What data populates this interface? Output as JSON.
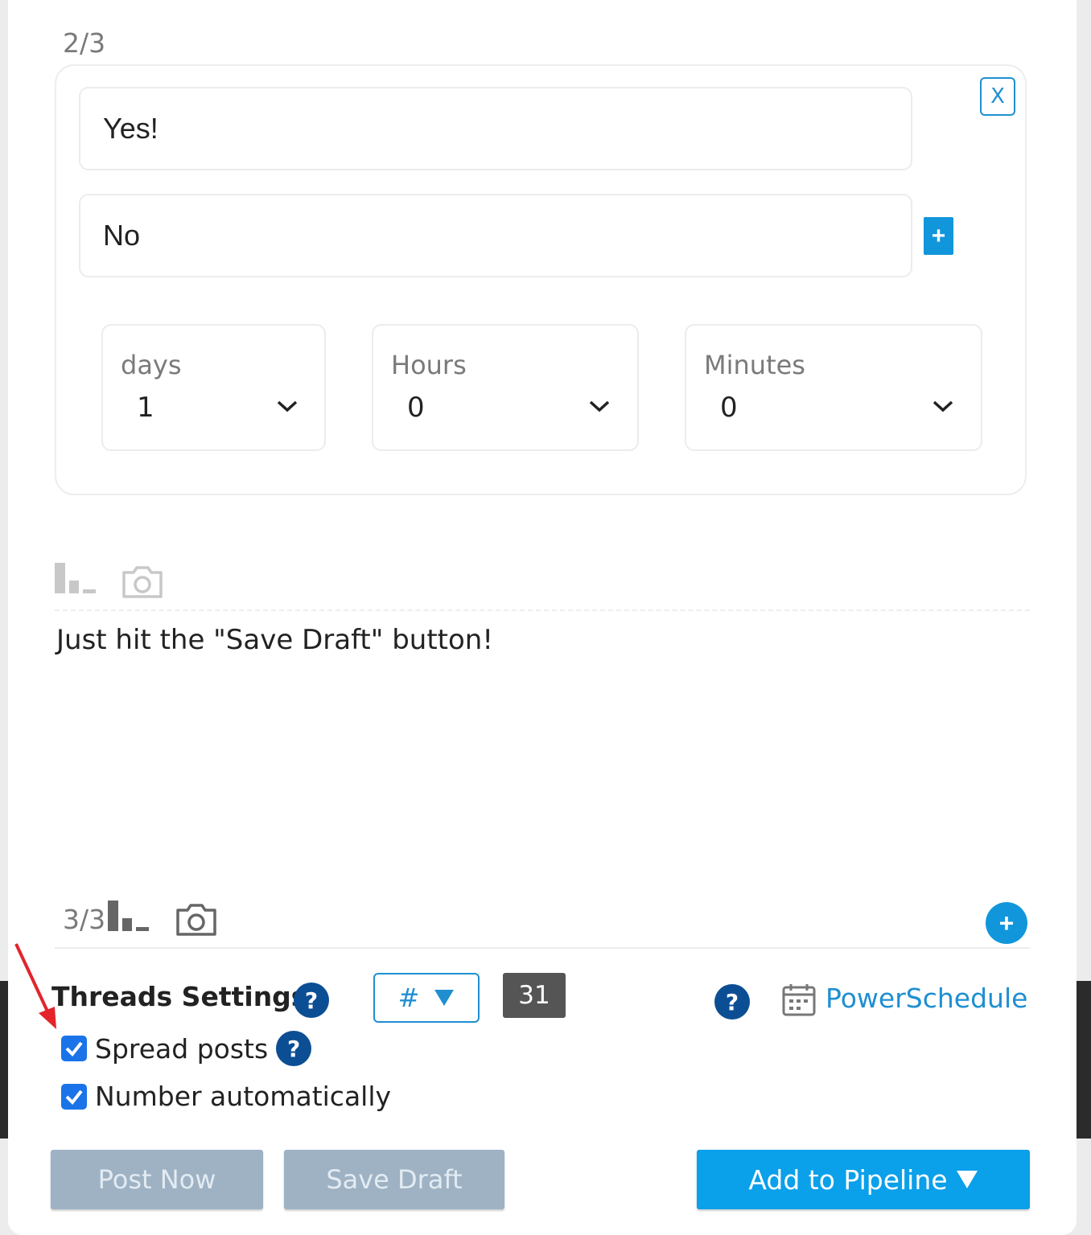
{
  "post2": {
    "counter": "2/3",
    "options": [
      {
        "value": "Yes!"
      },
      {
        "value": "No"
      }
    ],
    "close_label": "X",
    "add_option_label": "+",
    "duration": [
      {
        "label": "days",
        "value": "1"
      },
      {
        "label": "Hours",
        "value": "0"
      },
      {
        "label": "Minutes",
        "value": "0"
      }
    ],
    "icons": [
      "poll-icon",
      "camera-icon"
    ]
  },
  "post3": {
    "text": "Just hit the \"Save Draft\" button!",
    "counter": "3/3",
    "add_post_label": "+"
  },
  "settings": {
    "threads_label": "Threads Settings:",
    "help_label": "?",
    "numbering_symbol": "#",
    "char_count": "31",
    "powerschedule_label": "PowerSchedule",
    "spread_posts_label": "Spread posts",
    "spread_posts_checked": true,
    "number_auto_label": "Number automatically",
    "number_auto_checked": true
  },
  "actions": {
    "post_now": "Post Now",
    "save_draft": "Save Draft",
    "add_to_pipeline": "Add to Pipeline"
  },
  "colors": {
    "accent": "#1296db",
    "help_badge": "#0c4e94",
    "annotation_arrow": "#e3242b"
  }
}
